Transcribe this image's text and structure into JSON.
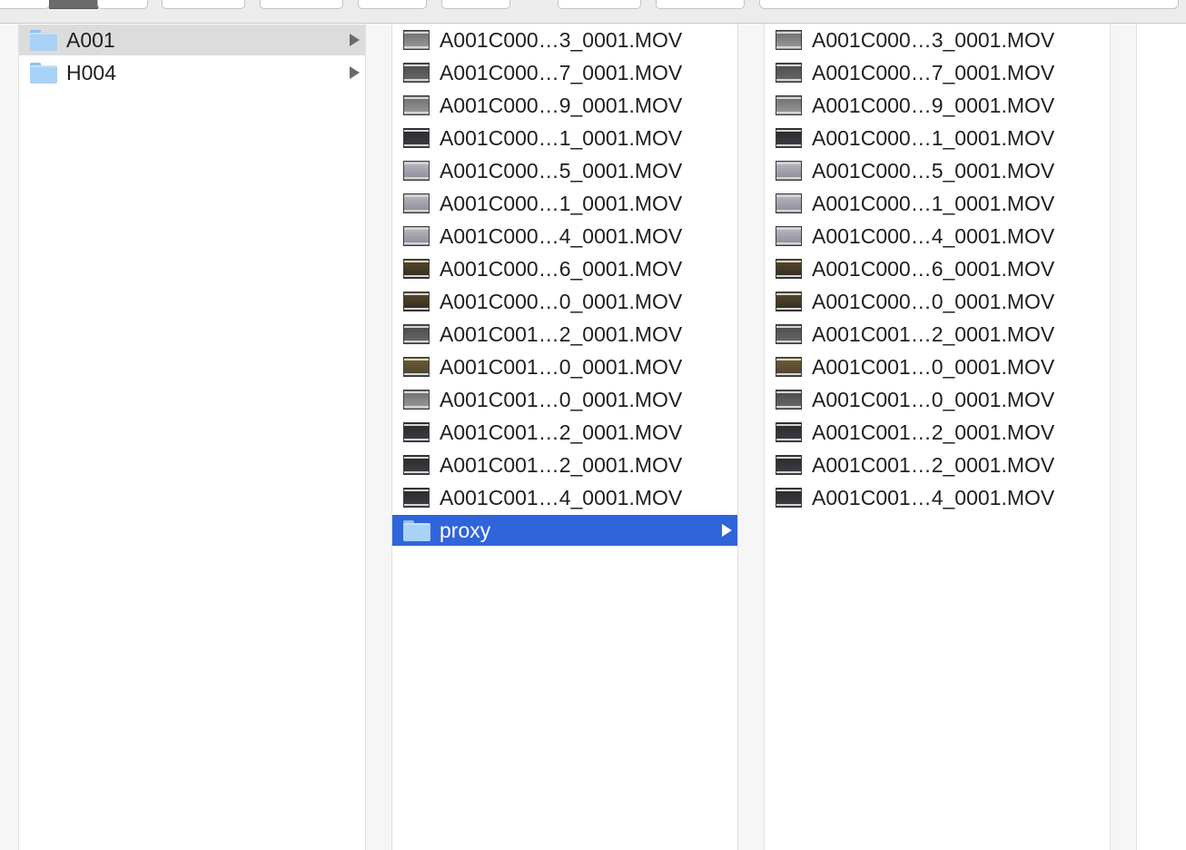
{
  "colors": {
    "selection_blue": "#3064db",
    "selection_gray": "#dcdcdc",
    "folder": "#a9d2f7"
  },
  "toolbar": {
    "buttons": [
      "view-columns-button",
      "group-button",
      "action-button",
      "share-button",
      "tags-button",
      "quicklook-button",
      "preview-button"
    ],
    "search_placeholder": ""
  },
  "columns": [
    {
      "name": "column-1",
      "items": [
        {
          "label": "A001",
          "kind": "folder",
          "selected": "gray",
          "has_children": true
        },
        {
          "label": "H004",
          "kind": "folder",
          "selected": "",
          "has_children": true
        }
      ]
    },
    {
      "name": "column-2",
      "items": [
        {
          "label": "A001C000…3_0001.MOV",
          "kind": "video",
          "thumb": "gray"
        },
        {
          "label": "A001C000…7_0001.MOV",
          "kind": "video",
          "thumb": "slate"
        },
        {
          "label": "A001C000…9_0001.MOV",
          "kind": "video",
          "thumb": "gray"
        },
        {
          "label": "A001C000…1_0001.MOV",
          "kind": "video",
          "thumb": "dark"
        },
        {
          "label": "A001C000…5_0001.MOV",
          "kind": "video",
          "thumb": "light"
        },
        {
          "label": "A001C000…1_0001.MOV",
          "kind": "video",
          "thumb": "light"
        },
        {
          "label": "A001C000…4_0001.MOV",
          "kind": "video",
          "thumb": "light"
        },
        {
          "label": "A001C000…6_0001.MOV",
          "kind": "video",
          "thumb": "warm"
        },
        {
          "label": "A001C000…0_0001.MOV",
          "kind": "video",
          "thumb": "warm"
        },
        {
          "label": "A001C001…2_0001.MOV",
          "kind": "video",
          "thumb": "slate"
        },
        {
          "label": "A001C001…0_0001.MOV",
          "kind": "video",
          "thumb": "olive"
        },
        {
          "label": "A001C001…0_0001.MOV",
          "kind": "video",
          "thumb": "gray"
        },
        {
          "label": "A001C001…2_0001.MOV",
          "kind": "video",
          "thumb": "dark"
        },
        {
          "label": "A001C001…2_0001.MOV",
          "kind": "video",
          "thumb": "dark"
        },
        {
          "label": "A001C001…4_0001.MOV",
          "kind": "video",
          "thumb": "dark"
        },
        {
          "label": "proxy",
          "kind": "folder",
          "selected": "blue",
          "has_children": true
        }
      ]
    },
    {
      "name": "column-3",
      "items": [
        {
          "label": "A001C000…3_0001.MOV",
          "kind": "video",
          "thumb": "gray"
        },
        {
          "label": "A001C000…7_0001.MOV",
          "kind": "video",
          "thumb": "slate"
        },
        {
          "label": "A001C000…9_0001.MOV",
          "kind": "video",
          "thumb": "gray"
        },
        {
          "label": "A001C000…1_0001.MOV",
          "kind": "video",
          "thumb": "dark"
        },
        {
          "label": "A001C000…5_0001.MOV",
          "kind": "video",
          "thumb": "light"
        },
        {
          "label": "A001C000…1_0001.MOV",
          "kind": "video",
          "thumb": "light"
        },
        {
          "label": "A001C000…4_0001.MOV",
          "kind": "video",
          "thumb": "light"
        },
        {
          "label": "A001C000…6_0001.MOV",
          "kind": "video",
          "thumb": "warm"
        },
        {
          "label": "A001C000…0_0001.MOV",
          "kind": "video",
          "thumb": "warm"
        },
        {
          "label": "A001C001…2_0001.MOV",
          "kind": "video",
          "thumb": "slate"
        },
        {
          "label": "A001C001…0_0001.MOV",
          "kind": "video",
          "thumb": "olive"
        },
        {
          "label": "A001C001…0_0001.MOV",
          "kind": "video",
          "thumb": "slate"
        },
        {
          "label": "A001C001…2_0001.MOV",
          "kind": "video",
          "thumb": "dark"
        },
        {
          "label": "A001C001…2_0001.MOV",
          "kind": "video",
          "thumb": "dark"
        },
        {
          "label": "A001C001…4_0001.MOV",
          "kind": "video",
          "thumb": "dark"
        }
      ]
    }
  ]
}
